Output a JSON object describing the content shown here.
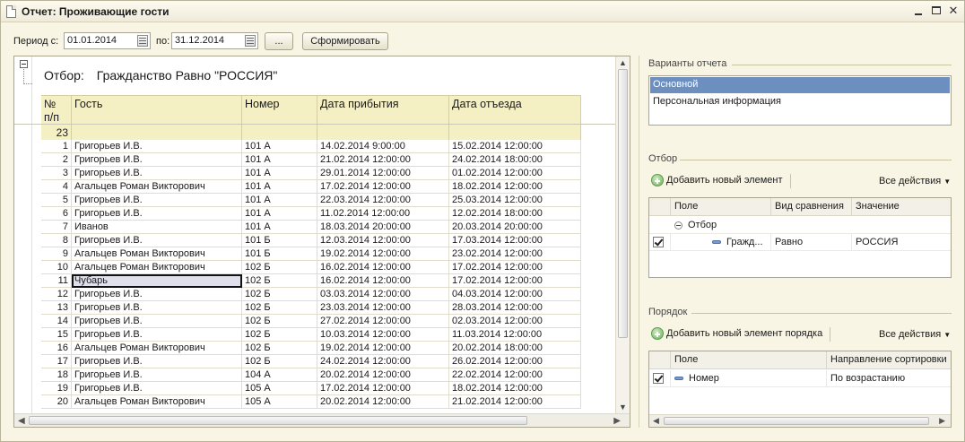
{
  "window": {
    "title": "Отчет: Проживающие гости",
    "icons": [
      "document-icon",
      "minimize-icon",
      "maximize-icon",
      "close-icon"
    ]
  },
  "period": {
    "from_label": "Период с:",
    "from_value": "01.01.2014",
    "to_label": "по:",
    "to_value": "31.12.2014",
    "choose_button": "...",
    "generate_button": "Сформировать"
  },
  "report": {
    "filter_label": "Отбор:",
    "filter_value": "Гражданство Равно \"РОССИЯ\"",
    "headers": {
      "num": "№\nп/п",
      "guest": "Гость",
      "room": "Номер",
      "arrival": "Дата прибытия",
      "departure": "Дата отъезда"
    },
    "group_count": "23",
    "rows": [
      {
        "n": "1",
        "guest": "Григорьев И.В.",
        "room": "101 А",
        "arrival": "14.02.2014 9:00:00",
        "departure": "15.02.2014 12:00:00"
      },
      {
        "n": "2",
        "guest": "Григорьев И.В.",
        "room": "101 А",
        "arrival": "21.02.2014 12:00:00",
        "departure": "24.02.2014 18:00:00"
      },
      {
        "n": "3",
        "guest": "Григорьев И.В.",
        "room": "101 А",
        "arrival": "29.01.2014 12:00:00",
        "departure": "01.02.2014 12:00:00"
      },
      {
        "n": "4",
        "guest": "Агальцев Роман Викторович",
        "room": "101 А",
        "arrival": "17.02.2014 12:00:00",
        "departure": "18.02.2014 12:00:00"
      },
      {
        "n": "5",
        "guest": "Григорьев И.В.",
        "room": "101 А",
        "arrival": "22.03.2014 12:00:00",
        "departure": "25.03.2014 12:00:00"
      },
      {
        "n": "6",
        "guest": "Григорьев И.В.",
        "room": "101 А",
        "arrival": "11.02.2014 12:00:00",
        "departure": "12.02.2014 18:00:00"
      },
      {
        "n": "7",
        "guest": "Иванов",
        "room": "101 А",
        "arrival": "18.03.2014 20:00:00",
        "departure": "20.03.2014 20:00:00"
      },
      {
        "n": "8",
        "guest": "Григорьев И.В.",
        "room": "101 Б",
        "arrival": "12.03.2014 12:00:00",
        "departure": "17.03.2014 12:00:00"
      },
      {
        "n": "9",
        "guest": "Агальцев Роман Викторович",
        "room": "101 Б",
        "arrival": "19.02.2014 12:00:00",
        "departure": "23.02.2014 12:00:00"
      },
      {
        "n": "10",
        "guest": "Агальцев Роман Викторович",
        "room": "102 Б",
        "arrival": "16.02.2014 12:00:00",
        "departure": "17.02.2014 12:00:00"
      },
      {
        "n": "11",
        "guest": "Чубарь",
        "room": "102 Б",
        "arrival": "16.02.2014 12:00:00",
        "departure": "17.02.2014 12:00:00"
      },
      {
        "n": "12",
        "guest": "Григорьев И.В.",
        "room": "102 Б",
        "arrival": "03.03.2014 12:00:00",
        "departure": "04.03.2014 12:00:00"
      },
      {
        "n": "13",
        "guest": "Григорьев И.В.",
        "room": "102 Б",
        "arrival": "23.03.2014 12:00:00",
        "departure": "28.03.2014 12:00:00"
      },
      {
        "n": "14",
        "guest": "Григорьев И.В.",
        "room": "102 Б",
        "arrival": "27.02.2014 12:00:00",
        "departure": "02.03.2014 12:00:00"
      },
      {
        "n": "15",
        "guest": "Григорьев И.В.",
        "room": "102 Б",
        "arrival": "10.03.2014 12:00:00",
        "departure": "11.03.2014 12:00:00"
      },
      {
        "n": "16",
        "guest": "Агальцев Роман Викторович",
        "room": "102 Б",
        "arrival": "19.02.2014 12:00:00",
        "departure": "20.02.2014 18:00:00"
      },
      {
        "n": "17",
        "guest": "Григорьев И.В.",
        "room": "102 Б",
        "arrival": "24.02.2014 12:00:00",
        "departure": "26.02.2014 12:00:00"
      },
      {
        "n": "18",
        "guest": "Григорьев И.В.",
        "room": "104 А",
        "arrival": "20.02.2014 12:00:00",
        "departure": "22.02.2014 12:00:00"
      },
      {
        "n": "19",
        "guest": "Григорьев И.В.",
        "room": "105 А",
        "arrival": "17.02.2014 12:00:00",
        "departure": "18.02.2014 12:00:00"
      },
      {
        "n": "20",
        "guest": "Агальцев Роман Викторович",
        "room": "105 А",
        "arrival": "20.02.2014 12:00:00",
        "departure": "21.02.2014 12:00:00"
      }
    ],
    "selected_row": "11"
  },
  "variants": {
    "title": "Варианты отчета",
    "items": [
      "Основной",
      "Персональная информация"
    ],
    "selected": "Основной"
  },
  "filter": {
    "title": "Отбор",
    "add_button": "Добавить новый элемент",
    "all_actions": "Все действия",
    "columns": [
      "Поле",
      "Вид сравнения",
      "Значение"
    ],
    "group_label": "Отбор",
    "item": {
      "field": "Гражд...",
      "comparison": "Равно",
      "value": "РОССИЯ",
      "checked": true
    }
  },
  "order": {
    "title": "Порядок",
    "add_button": "Добавить новый элемент порядка",
    "all_actions": "Все действия",
    "columns": [
      "Поле",
      "Направление сортировки"
    ],
    "item": {
      "field": "Номер",
      "direction": "По возрастанию",
      "checked": true
    }
  },
  "colors": {
    "window_bg": "#f8f5e4",
    "header_bg": "#f5f0c4",
    "selection": "#6d8fbf"
  }
}
